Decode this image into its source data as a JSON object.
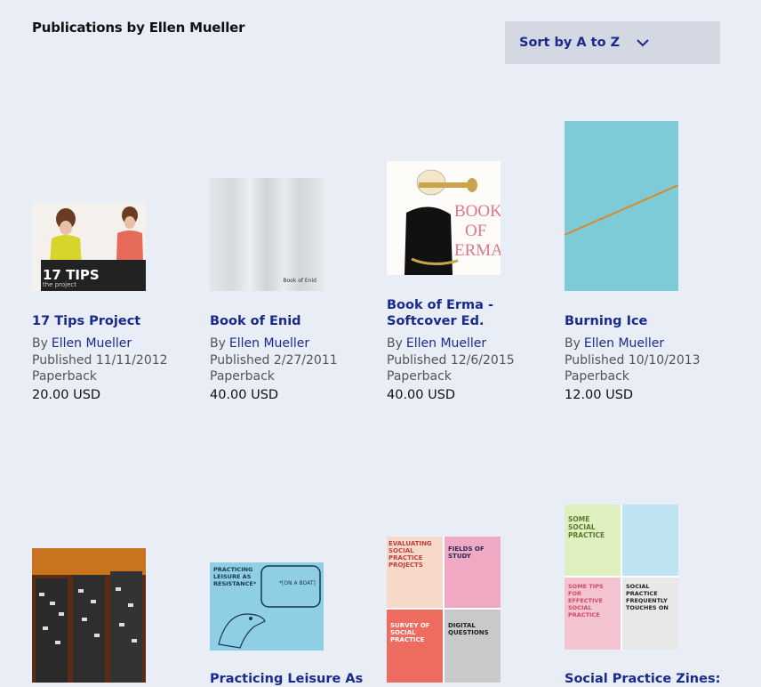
{
  "header": {
    "title": "Publications by Ellen Mueller",
    "sort_label": "Sort by A to Z"
  },
  "colors": {
    "accent": "#1b2a8c",
    "background": "#e8edf6",
    "dropdown_bg": "#d3d8e3"
  },
  "publications": [
    {
      "title": "17 Tips Project",
      "by": "By",
      "author": "Ellen Mueller",
      "published": "Published 11/11/2012",
      "format": "Paperback",
      "price": "20.00 USD",
      "cover_text": "17 TIPS",
      "cover_subtext": "the project"
    },
    {
      "title": "Book of Enid",
      "by": "By",
      "author": "Ellen Mueller",
      "published": "Published 2/27/2011",
      "format": "Paperback",
      "price": "40.00 USD",
      "cover_text": "Book of Enid"
    },
    {
      "title": "Book of Erma - Softcover Ed.",
      "by": "By",
      "author": "Ellen Mueller",
      "published": "Published 12/6/2015",
      "format": "Paperback",
      "price": "40.00 USD",
      "cover_text_1": "BOOK",
      "cover_text_2": "OF",
      "cover_text_3": "ERMA"
    },
    {
      "title": "Burning Ice",
      "by": "By",
      "author": "Ellen Mueller",
      "published": "Published 10/10/2013",
      "format": "Paperback",
      "price": "12.00 USD"
    },
    {
      "title": ""
    },
    {
      "title": "Practicing Leisure As",
      "cover_text": "PRACTICING LEISURE AS RESISTANCE*",
      "cover_bubble": "*[ON A BOAT]"
    },
    {
      "title": "",
      "cover_text_1": "EVALUATING SOCIAL PRACTICE PROJECTS",
      "cover_text_2": "FIELDS OF STUDY",
      "cover_text_3": "SURVEY OF SOCIAL PRACTICE",
      "cover_text_4": "DIGITAL QUESTIONS"
    },
    {
      "title": "Social Practice Zines:",
      "cover_text_1": "SOME SOCIAL PRACTICE",
      "cover_text_2": "SOME TIPS FOR EFFECTIVE SOCIAL PRACTICE",
      "cover_text_3": "SOCIAL PRACTICE FREQUENTLY TOUCHES ON"
    }
  ]
}
